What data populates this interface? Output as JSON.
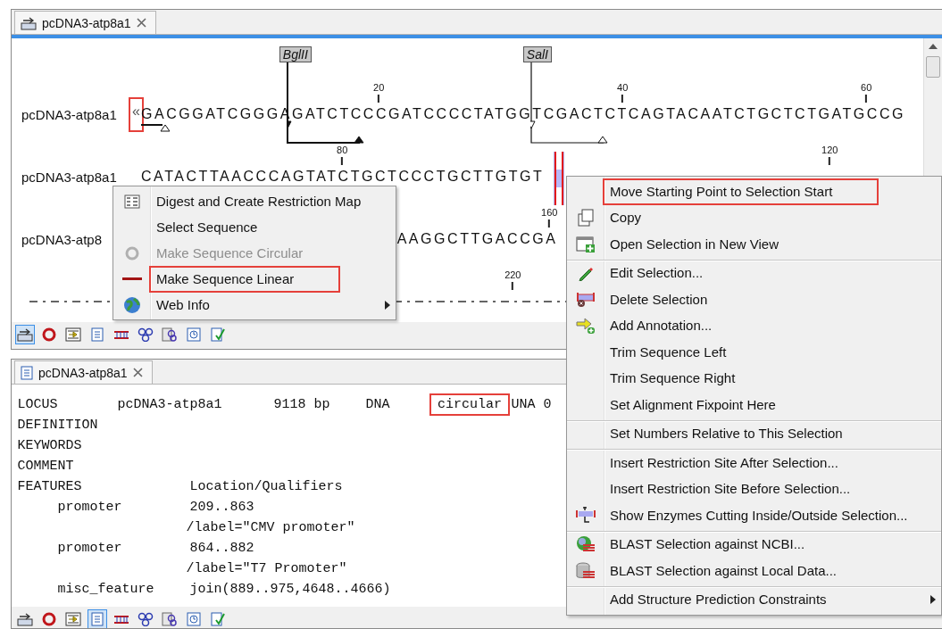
{
  "top_panel": {
    "tab": {
      "label": "pcDNA3-atp8a1",
      "selected": true
    },
    "sequence_rows": [
      {
        "kind": "full",
        "label": "pcDNA3-atp8a1",
        "start_marker": {
          "text": "«",
          "highlighted": true
        },
        "sequence": "GACGGATCGGGAGATCTCCCGATCCCCTATGGTCGACTCTCAGTACAATCTGCTCTGATGCCG",
        "ticks": [
          "20",
          "40",
          "60"
        ],
        "enzymes": [
          "BglII",
          "SalI"
        ]
      },
      {
        "kind": "full",
        "label": "pcDNA3-atp8a1",
        "sequence": "CATACTTAACCCAGTATCTGCTCCCTGCTTGTGT",
        "ticks": [
          "80",
          "120"
        ],
        "selection": true
      },
      {
        "kind": "covered",
        "label": "pcDNA3-atp8",
        "sequence": "AAGGCTTGACCGA",
        "ticks": [
          "160"
        ]
      },
      {
        "kind": "dashes",
        "ticks": [
          "220"
        ]
      }
    ],
    "toolbar": [
      {
        "selected": true
      },
      {
        "selected": false
      },
      {
        "selected": false
      },
      {
        "selected": false
      },
      {
        "selected": false
      },
      {
        "selected": false
      },
      {
        "selected": false
      },
      {
        "selected": false
      },
      {
        "selected": false
      }
    ]
  },
  "bottom_panel": {
    "tab": {
      "label": "pcDNA3-atp8a1",
      "selected": true
    },
    "genbank_lines": [
      {
        "kind": "locus",
        "cells": [
          {
            "text": "LOCUS",
            "highlighted": false
          },
          {
            "text": "pcDNA3-atp8a1",
            "highlighted": false
          },
          {
            "text": "9118 bp",
            "highlighted": false
          },
          {
            "text": "DNA",
            "highlighted": false
          },
          {
            "text": "circular",
            "highlighted": true
          },
          {
            "text": "UNA 0",
            "highlighted": false
          }
        ]
      },
      {
        "kind": "header",
        "cells": [
          "DEFINITION"
        ]
      },
      {
        "kind": "header",
        "cells": [
          "KEYWORDS"
        ]
      },
      {
        "kind": "header",
        "cells": [
          "COMMENT"
        ]
      },
      {
        "kind": "header",
        "cells": [
          "FEATURES",
          "Location/Qualifiers"
        ]
      },
      {
        "kind": "feature",
        "cells": [
          "promoter",
          "209..863"
        ]
      },
      {
        "kind": "qualifier",
        "cells": [
          "/label=\"CMV promoter\""
        ]
      },
      {
        "kind": "feature",
        "cells": [
          "promoter",
          "864..882"
        ]
      },
      {
        "kind": "qualifier",
        "cells": [
          "/label=\"T7 Promoter\""
        ]
      },
      {
        "kind": "feature",
        "cells": [
          "misc_feature",
          "join(889..975,4648..4666)"
        ]
      }
    ],
    "toolbar": [
      {
        "selected": false
      },
      {
        "selected": false
      },
      {
        "selected": false
      },
      {
        "selected": true
      },
      {
        "selected": false
      },
      {
        "selected": false
      },
      {
        "selected": false
      },
      {
        "selected": false
      },
      {
        "selected": false
      }
    ]
  },
  "context_menus": [
    {
      "items": [
        {
          "label": "Digest and Create Restriction Map",
          "disabled": false,
          "highlighted": false,
          "submenu": false,
          "separator_before": false
        },
        {
          "label": "Select Sequence",
          "disabled": false,
          "highlighted": false,
          "submenu": false,
          "separator_before": false
        },
        {
          "label": "Make Sequence Circular",
          "disabled": true,
          "highlighted": false,
          "submenu": false,
          "separator_before": false
        },
        {
          "label": "Make Sequence Linear",
          "disabled": false,
          "highlighted": true,
          "submenu": false,
          "separator_before": false
        },
        {
          "label": "Web Info",
          "disabled": false,
          "highlighted": false,
          "submenu": true,
          "separator_before": false
        }
      ]
    },
    {
      "items": [
        {
          "label": "Move Starting Point to Selection Start",
          "disabled": false,
          "highlighted": true,
          "submenu": false,
          "separator_before": false
        },
        {
          "label": "Copy",
          "disabled": false,
          "highlighted": false,
          "submenu": false,
          "separator_before": false
        },
        {
          "label": "Open Selection in New View",
          "disabled": false,
          "highlighted": false,
          "submenu": false,
          "separator_before": false
        },
        {
          "label": "Edit Selection...",
          "disabled": false,
          "highlighted": false,
          "submenu": false,
          "separator_before": true
        },
        {
          "label": "Delete Selection",
          "disabled": false,
          "highlighted": false,
          "submenu": false,
          "separator_before": false
        },
        {
          "label": "Add Annotation...",
          "disabled": false,
          "highlighted": false,
          "submenu": false,
          "separator_before": false
        },
        {
          "label": "Trim Sequence Left",
          "disabled": false,
          "highlighted": false,
          "submenu": false,
          "separator_before": false
        },
        {
          "label": "Trim Sequence Right",
          "disabled": false,
          "highlighted": false,
          "submenu": false,
          "separator_before": false
        },
        {
          "label": "Set Alignment Fixpoint Here",
          "disabled": false,
          "highlighted": false,
          "submenu": false,
          "separator_before": false
        },
        {
          "label": "Set Numbers Relative to This Selection",
          "disabled": false,
          "highlighted": false,
          "submenu": false,
          "separator_before": true
        },
        {
          "label": "Insert Restriction Site After Selection...",
          "disabled": false,
          "highlighted": false,
          "submenu": false,
          "separator_before": true
        },
        {
          "label": "Insert Restriction Site Before Selection...",
          "disabled": false,
          "highlighted": false,
          "submenu": false,
          "separator_before": false
        },
        {
          "label": "Show Enzymes Cutting Inside/Outside Selection...",
          "disabled": false,
          "highlighted": false,
          "submenu": false,
          "separator_before": false
        },
        {
          "label": "BLAST Selection against NCBI...",
          "disabled": false,
          "highlighted": false,
          "submenu": false,
          "separator_before": true
        },
        {
          "label": "BLAST Selection against Local Data...",
          "disabled": false,
          "highlighted": false,
          "submenu": false,
          "separator_before": false
        },
        {
          "label": "Add Structure Prediction Constraints",
          "disabled": false,
          "highlighted": false,
          "submenu": true,
          "separator_before": true
        }
      ]
    }
  ]
}
